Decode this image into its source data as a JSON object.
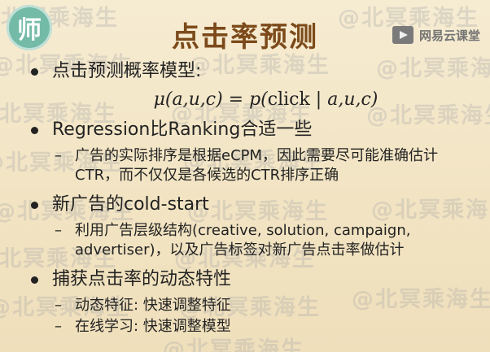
{
  "slide": {
    "logo_char": "师",
    "title": "点击率预测",
    "brand": {
      "name": "网易云课堂",
      "icon": "play-icon"
    },
    "watermark_text": "@北冥乘海生",
    "bullets": [
      {
        "text": "点击预测概率模型:"
      },
      {
        "text": "Regression比Ranking合适一些"
      },
      {
        "text": "新广告的cold-start"
      },
      {
        "text": "捕获点击率的动态特性"
      }
    ],
    "formula": {
      "lhs": "μ(a,u,c)",
      "eq": " = ",
      "rhs_p": "p(",
      "rhs_click": "click",
      "rhs_rest": " | a,u,c)"
    },
    "sub_bullets": [
      {
        "text": "广告的实际排序是根据eCPM，因此需要尽可能准确估计CTR，而不仅仅是各候选的CTR排序正确"
      },
      {
        "text": "利用广告层级结构(creative, solution, campaign, advertiser)，以及广告标签对新广告点击率做估计"
      },
      {
        "text": "动态特征: 快速调整特征"
      },
      {
        "text": "在线学习: 快速调整模型"
      }
    ]
  }
}
